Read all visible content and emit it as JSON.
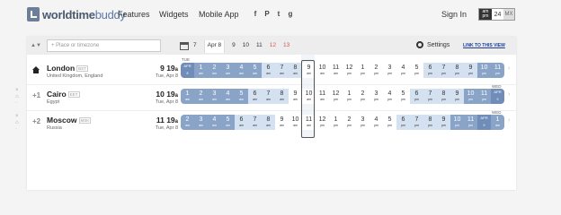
{
  "header": {
    "logo_bold": "worldtime",
    "logo_light": "buddy",
    "nav": [
      "Features",
      "Widgets",
      "Mobile App"
    ],
    "social": [
      "f",
      "P",
      "t",
      "g"
    ],
    "signin": "Sign In",
    "format": {
      "ampm": "am pm",
      "h24": "24",
      "mx": "MX"
    }
  },
  "toolbar": {
    "search_placeholder": "Place or timezone",
    "days": [
      "7",
      "Apr 8",
      "9",
      "10",
      "11",
      "12",
      "13"
    ],
    "settings": "Settings",
    "link": "LINK TO THIS VIEW"
  },
  "rows": [
    {
      "offset": "",
      "city": "London",
      "abbr": "BST",
      "country": "United Kingdom, England",
      "time": "9 19",
      "time_suffix": "a",
      "date": "Tue, Apr 8",
      "day_label_start": "TUE",
      "day_label_end": "",
      "hours": [
        {
          "v": "APR",
          "s": "8",
          "t": "mid"
        },
        {
          "v": "1",
          "s": "am",
          "t": "night"
        },
        {
          "v": "2",
          "s": "am",
          "t": "night"
        },
        {
          "v": "3",
          "s": "am",
          "t": "night"
        },
        {
          "v": "4",
          "s": "am",
          "t": "night"
        },
        {
          "v": "5",
          "s": "am",
          "t": "night"
        },
        {
          "v": "6",
          "s": "am",
          "t": "dawn"
        },
        {
          "v": "7",
          "s": "am",
          "t": "dawn"
        },
        {
          "v": "8",
          "s": "am",
          "t": "dawn"
        },
        {
          "v": "9",
          "s": "am",
          "t": "day"
        },
        {
          "v": "10",
          "s": "am",
          "t": "day"
        },
        {
          "v": "11",
          "s": "am",
          "t": "day"
        },
        {
          "v": "12",
          "s": "pm",
          "t": "day"
        },
        {
          "v": "1",
          "s": "pm",
          "t": "day"
        },
        {
          "v": "2",
          "s": "pm",
          "t": "day"
        },
        {
          "v": "3",
          "s": "pm",
          "t": "day"
        },
        {
          "v": "4",
          "s": "pm",
          "t": "day"
        },
        {
          "v": "5",
          "s": "pm",
          "t": "day"
        },
        {
          "v": "6",
          "s": "pm",
          "t": "dawn"
        },
        {
          "v": "7",
          "s": "pm",
          "t": "dawn"
        },
        {
          "v": "8",
          "s": "pm",
          "t": "dawn"
        },
        {
          "v": "9",
          "s": "pm",
          "t": "dawn"
        },
        {
          "v": "10",
          "s": "pm",
          "t": "night"
        },
        {
          "v": "11",
          "s": "pm",
          "t": "night"
        }
      ]
    },
    {
      "offset": "+1",
      "city": "Cairo",
      "abbr": "EET",
      "country": "Egypt",
      "time": "10 19",
      "time_suffix": "a",
      "date": "Tue, Apr 8",
      "day_label_start": "",
      "day_label_end": "WED",
      "hours": [
        {
          "v": "1",
          "s": "am",
          "t": "night"
        },
        {
          "v": "2",
          "s": "am",
          "t": "night"
        },
        {
          "v": "3",
          "s": "am",
          "t": "night"
        },
        {
          "v": "4",
          "s": "am",
          "t": "night"
        },
        {
          "v": "5",
          "s": "am",
          "t": "night"
        },
        {
          "v": "6",
          "s": "am",
          "t": "dawn"
        },
        {
          "v": "7",
          "s": "am",
          "t": "dawn"
        },
        {
          "v": "8",
          "s": "am",
          "t": "dawn"
        },
        {
          "v": "9",
          "s": "am",
          "t": "day"
        },
        {
          "v": "10",
          "s": "am",
          "t": "day"
        },
        {
          "v": "11",
          "s": "am",
          "t": "day"
        },
        {
          "v": "12",
          "s": "pm",
          "t": "day"
        },
        {
          "v": "1",
          "s": "pm",
          "t": "day"
        },
        {
          "v": "2",
          "s": "pm",
          "t": "day"
        },
        {
          "v": "3",
          "s": "pm",
          "t": "day"
        },
        {
          "v": "4",
          "s": "pm",
          "t": "day"
        },
        {
          "v": "5",
          "s": "pm",
          "t": "day"
        },
        {
          "v": "6",
          "s": "pm",
          "t": "dawn"
        },
        {
          "v": "7",
          "s": "pm",
          "t": "dawn"
        },
        {
          "v": "8",
          "s": "pm",
          "t": "dawn"
        },
        {
          "v": "9",
          "s": "pm",
          "t": "dawn"
        },
        {
          "v": "10",
          "s": "pm",
          "t": "night"
        },
        {
          "v": "11",
          "s": "pm",
          "t": "night"
        },
        {
          "v": "APR",
          "s": "9",
          "t": "mid"
        }
      ]
    },
    {
      "offset": "+2",
      "city": "Moscow",
      "abbr": "MSK",
      "country": "Russia",
      "time": "11 19",
      "time_suffix": "a",
      "date": "Tue, Apr 8",
      "day_label_start": "",
      "day_label_end": "WED",
      "hours": [
        {
          "v": "2",
          "s": "am",
          "t": "night"
        },
        {
          "v": "3",
          "s": "am",
          "t": "night"
        },
        {
          "v": "4",
          "s": "am",
          "t": "night"
        },
        {
          "v": "5",
          "s": "am",
          "t": "night"
        },
        {
          "v": "6",
          "s": "am",
          "t": "dawn"
        },
        {
          "v": "7",
          "s": "am",
          "t": "dawn"
        },
        {
          "v": "8",
          "s": "am",
          "t": "dawn"
        },
        {
          "v": "9",
          "s": "am",
          "t": "day"
        },
        {
          "v": "10",
          "s": "am",
          "t": "day"
        },
        {
          "v": "11",
          "s": "am",
          "t": "day"
        },
        {
          "v": "12",
          "s": "pm",
          "t": "day"
        },
        {
          "v": "1",
          "s": "pm",
          "t": "day"
        },
        {
          "v": "2",
          "s": "pm",
          "t": "day"
        },
        {
          "v": "3",
          "s": "pm",
          "t": "day"
        },
        {
          "v": "4",
          "s": "pm",
          "t": "day"
        },
        {
          "v": "5",
          "s": "pm",
          "t": "day"
        },
        {
          "v": "6",
          "s": "pm",
          "t": "dawn"
        },
        {
          "v": "7",
          "s": "pm",
          "t": "dawn"
        },
        {
          "v": "8",
          "s": "pm",
          "t": "dawn"
        },
        {
          "v": "9",
          "s": "pm",
          "t": "dawn"
        },
        {
          "v": "10",
          "s": "pm",
          "t": "night"
        },
        {
          "v": "11",
          "s": "pm",
          "t": "night"
        },
        {
          "v": "APR",
          "s": "9",
          "t": "mid"
        },
        {
          "v": "1",
          "s": "am",
          "t": "night"
        }
      ]
    }
  ]
}
